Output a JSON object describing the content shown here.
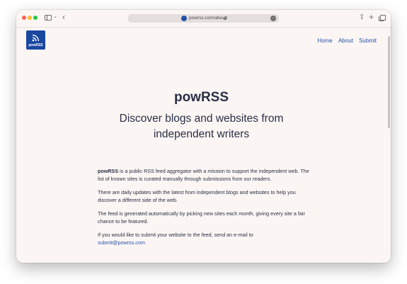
{
  "browser": {
    "url": "powrss.com/about",
    "more_icon": "…"
  },
  "site": {
    "logo_text": "powRSS",
    "nav": [
      "Home",
      "About",
      "Submit"
    ],
    "title": "powRSS",
    "tagline": "Discover blogs and websites from independent writers"
  },
  "about": {
    "p1_bold": "powRSS",
    "p1_rest": " is a public RSS feed aggregator with a mission to support the independent web. The list of known sites is curated manually through submissions from our readers.",
    "p2": "There are daily updates with the latest from independent blogs and websites to help you discover a different side of the web.",
    "p3": "The feed is generated automatically by picking new sites each month, giving every site a fair chance to be featured.",
    "p4": "If you would like to submit your website to the feed, send an e-mail to",
    "email": "submit@powrss.com"
  },
  "colors": {
    "brand": "#1a48a0",
    "link": "#2752a8",
    "text": "#2a2f45",
    "page_bg": "#fbf6f4"
  },
  "icons": [
    "sidebar-toggle-icon",
    "chevron-down-icon",
    "back-arrow-icon",
    "site-favicon-icon",
    "lock-icon",
    "more-icon",
    "share-icon",
    "new-tab-plus-icon",
    "tabs-overview-icon",
    "rss-icon"
  ]
}
